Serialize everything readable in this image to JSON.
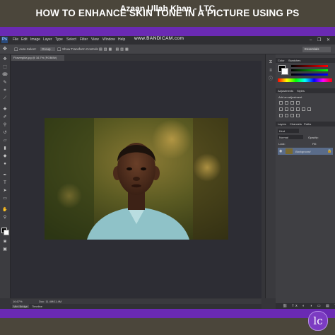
{
  "header": {
    "title": "HOW TO ENHANCE SKIN TONE IN A PICTURE USING PS"
  },
  "footer": {
    "credit": "Azaan Ullah Khan - LTC",
    "logo_letter": "lc"
  },
  "photoshop": {
    "app_logo": "Ps",
    "menu": [
      "File",
      "Edit",
      "Image",
      "Layer",
      "Type",
      "Select",
      "Filter",
      "View",
      "Window",
      "Help"
    ],
    "watermark": "www.BANDICAM.com",
    "window_controls": "– ❐ ✕",
    "options": {
      "auto_select": "Auto-Select:",
      "auto_select_value": "Group",
      "show_transform": "Show Transform Controls"
    },
    "workspace": "Essentials",
    "document_tab": "Flowerglitz.jpg @ 16.7% (RGB/8#)",
    "status": {
      "zoom": "16.67%",
      "doc_size": "Doc: 11.4M/11.4M"
    },
    "bottom_tabs": [
      "Mini Bridge",
      "Timeline"
    ],
    "panels": {
      "color_tabs": [
        "Color",
        "Swatches"
      ],
      "adjustments_tabs": [
        "Adjustments",
        "Styles"
      ],
      "adjustments_hint": "Add an adjustment",
      "layers_tabs": [
        "Layers",
        "Channels",
        "Paths"
      ],
      "layers_filter": "Kind",
      "blend_mode": "Normal",
      "opacity_label": "Opacity:",
      "fill_label": "Fill:",
      "lock_label": "Lock:",
      "layer_name": "Background"
    },
    "colors": {
      "accent_purple": "#6a2ab3",
      "ps_background": "#353539",
      "canvas_bg": "#2d2d34"
    }
  }
}
